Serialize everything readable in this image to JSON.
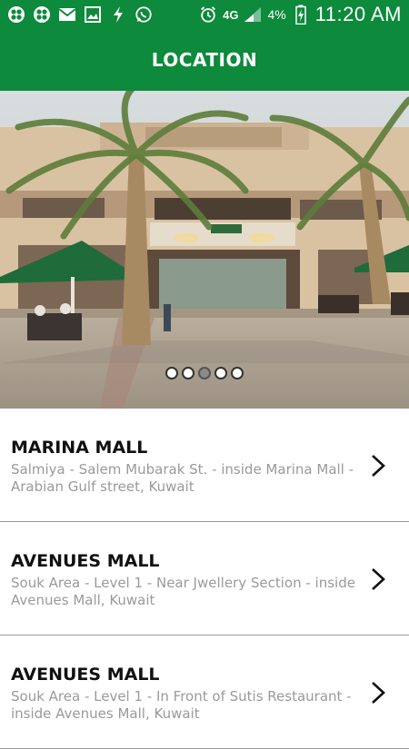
{
  "status_bar": {
    "left_icons": [
      "clover-icon",
      "clover-icon",
      "mail-icon",
      "image-icon",
      "flash-icon",
      "whatsapp-icon"
    ],
    "network": "4G",
    "battery": "4%",
    "time": "11:20 AM"
  },
  "app_bar": {
    "title": "LOCATION"
  },
  "carousel": {
    "page_count": 5,
    "active_index": 2
  },
  "locations": [
    {
      "name": "MARINA MALL",
      "address": "Salmiya - Salem Mubarak St. - inside Marina Mall - Arabian Gulf street, Kuwait"
    },
    {
      "name": "AVENUES MALL",
      "address": "Souk Area - Level 1 - Near Jwellery Section - inside Avenues Mall, Kuwait"
    },
    {
      "name": "AVENUES MALL",
      "address": "Souk Area - Level 1 - In Front of Sutis Restaurant -  inside Avenues Mall, Kuwait"
    }
  ],
  "colors": {
    "primary": "#0d8a3c",
    "address_text": "#9a9a9a"
  }
}
